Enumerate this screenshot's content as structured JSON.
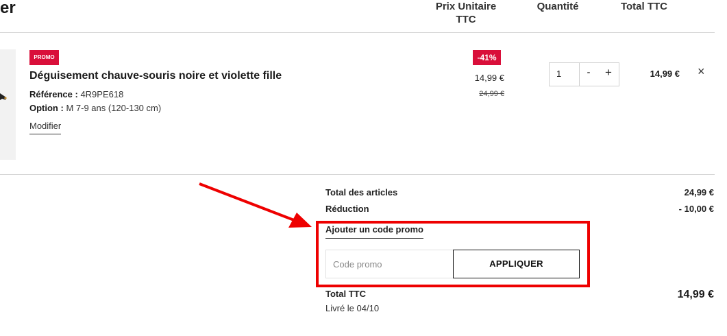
{
  "header": {
    "title_partial": "er",
    "col_unit_price": "Prix Unitaire TTC",
    "col_quantity": "Quantité",
    "col_total": "Total TTC"
  },
  "product": {
    "promo_badge": "PROMO",
    "name": "Déguisement chauve-souris noire et violette fille",
    "reference_label": "Référence :",
    "reference_value": "4R9PE618",
    "option_label": "Option :",
    "option_value": "M 7-9 ans (120-130 cm)",
    "modify_label": "Modifier",
    "discount_badge": "-41%",
    "unit_price": "14,99 €",
    "old_price": "24,99 €",
    "quantity": "1",
    "minus_label": "-",
    "plus_label": "+",
    "line_total": "14,99 €",
    "remove_label": "×"
  },
  "summary": {
    "items_total_label": "Total des articles",
    "items_total_value": "24,99 €",
    "reduction_label": "Réduction",
    "reduction_value": "- 10,00 €",
    "add_promo_label": "Ajouter un code promo",
    "promo_placeholder": "Code promo",
    "apply_label": "APPLIQUER",
    "total_label": "Total TTC",
    "total_value": "14,99 €",
    "delivery": "Livré le 04/10"
  },
  "colors": {
    "promo_red": "#d90f3a",
    "annotation_red": "#ee0000",
    "divider": "#d6d6d6"
  },
  "icons": {
    "remove": "close-icon",
    "annotation": "arrow-icon"
  }
}
